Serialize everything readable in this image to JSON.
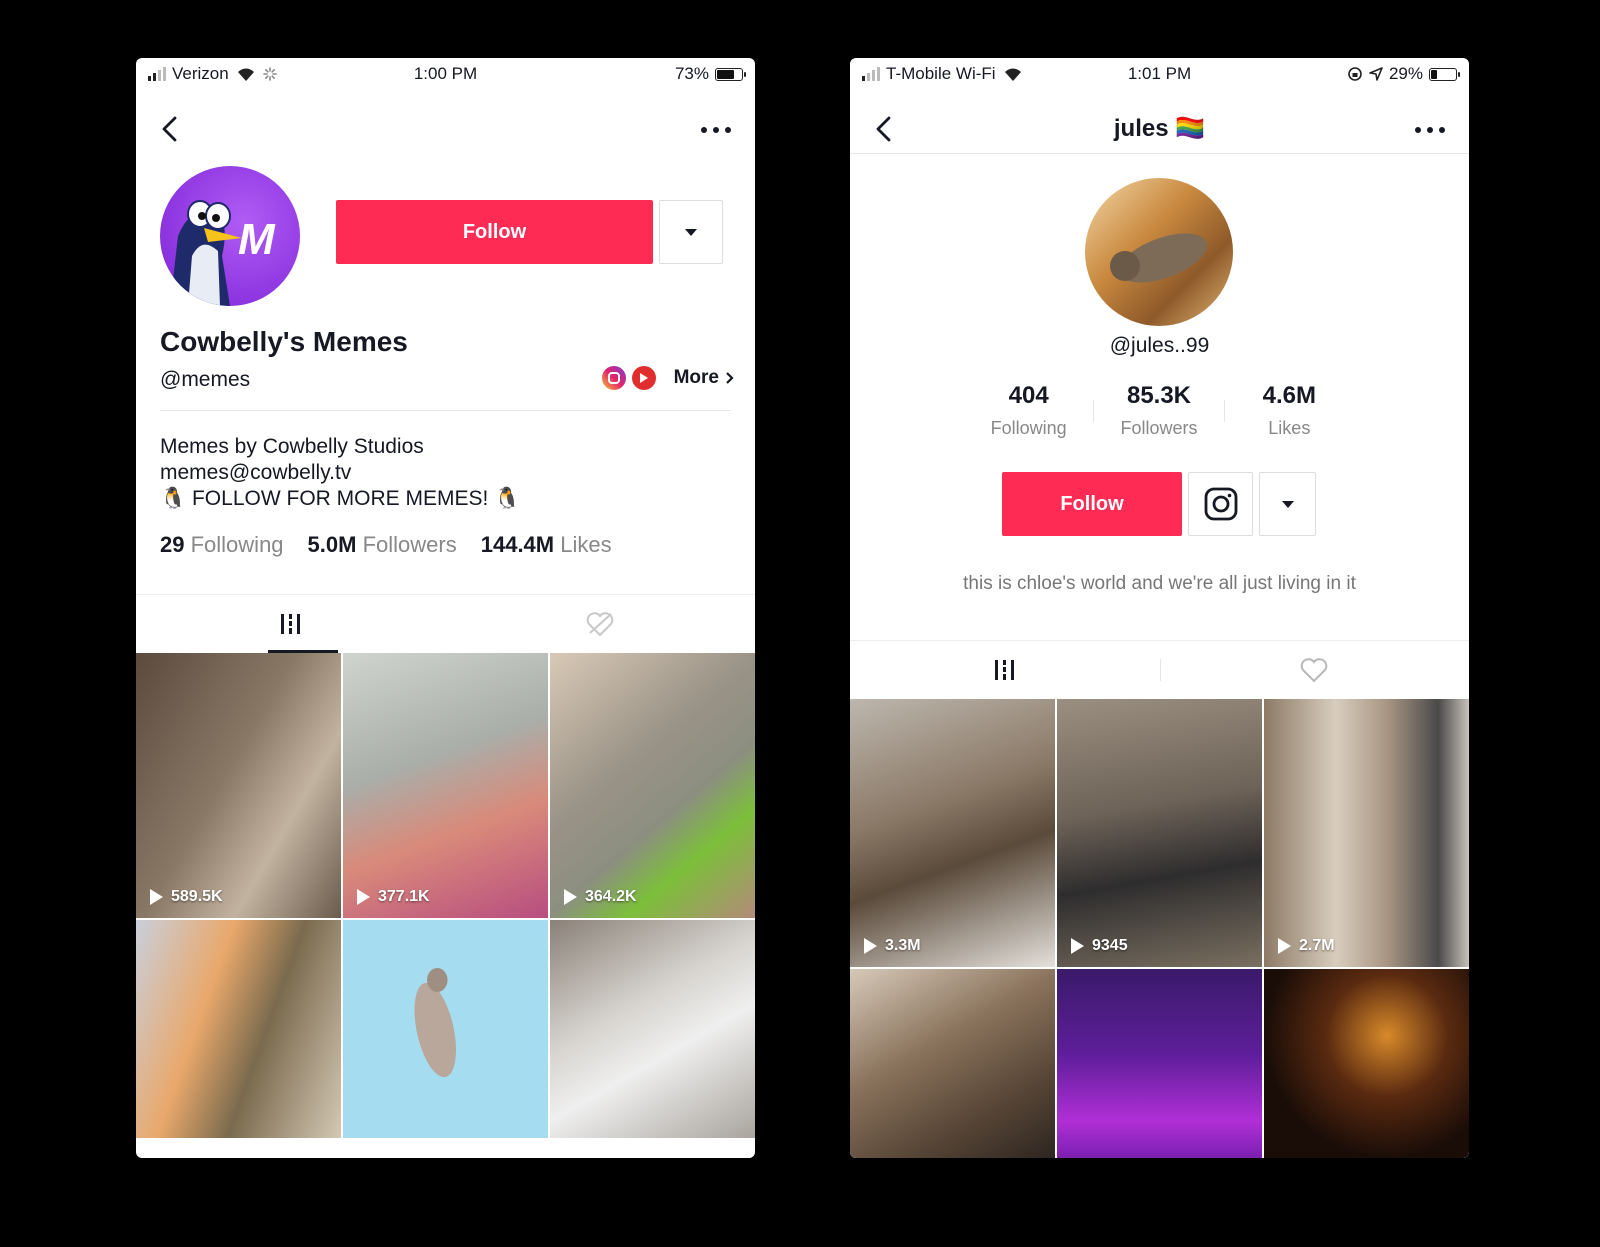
{
  "left": {
    "status": {
      "carrier": "Verizon",
      "time": "1:00 PM",
      "battery": "73%"
    },
    "follow_label": "Follow",
    "display_name": "Cowbelly's Memes",
    "handle": "@memes",
    "more_label": "More",
    "bio": [
      "Memes by Cowbelly Studios",
      "memes@cowbelly.tv",
      "🐧 FOLLOW FOR MORE MEMES! 🐧"
    ],
    "stats": [
      {
        "value": "29",
        "label": "Following"
      },
      {
        "value": "5.0M",
        "label": "Followers"
      },
      {
        "value": "144.4M",
        "label": "Likes"
      }
    ],
    "videos": [
      {
        "views": "589.5K"
      },
      {
        "views": "377.1K"
      },
      {
        "views": "364.2K"
      },
      {
        "views": ""
      },
      {
        "views": ""
      },
      {
        "views": ""
      }
    ]
  },
  "right": {
    "status": {
      "carrier": "T-Mobile Wi-Fi",
      "time": "1:01 PM",
      "battery": "29%"
    },
    "title": "jules 🏳️‍🌈",
    "handle": "@jules..99",
    "stats": [
      {
        "value": "404",
        "label": "Following"
      },
      {
        "value": "85.3K",
        "label": "Followers"
      },
      {
        "value": "4.6M",
        "label": "Likes"
      }
    ],
    "follow_label": "Follow",
    "bio": "this is chloe's world and we're all just living in it",
    "videos": [
      {
        "views": "3.3M"
      },
      {
        "views": "9345"
      },
      {
        "views": "2.7M"
      },
      {
        "views": ""
      },
      {
        "views": ""
      },
      {
        "views": ""
      }
    ]
  },
  "colors": {
    "accent": "#fe2c55",
    "avatar_purple": "#8d34e0"
  }
}
